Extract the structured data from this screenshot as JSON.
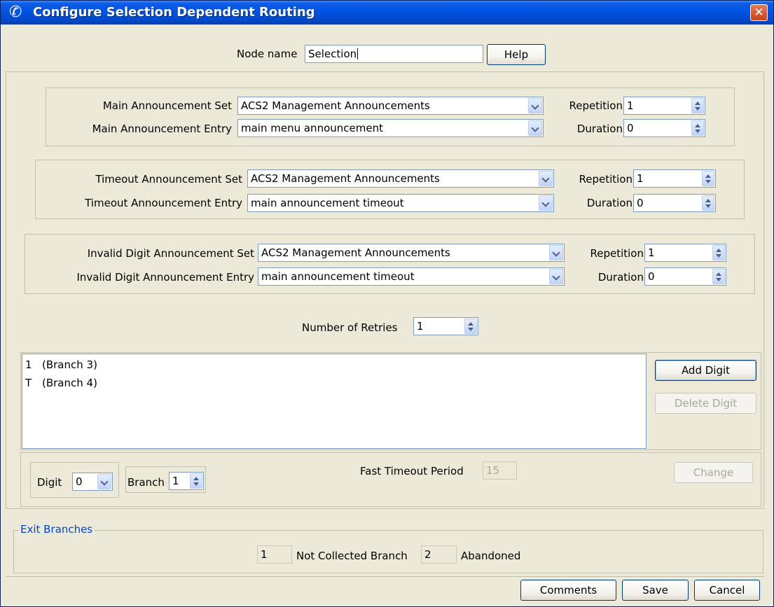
{
  "window": {
    "title": "Configure Selection Dependent Routing",
    "close_glyph": "✕",
    "icon": "phone-icon"
  },
  "node": {
    "label": "Node name",
    "value": "Selection",
    "help_label": "Help"
  },
  "main": {
    "set_label": "Main Announcement Set",
    "set_value": "ACS2 Management Announcements",
    "entry_label": "Main Announcement Entry",
    "entry_value": "main menu announcement",
    "repetition_label": "Repetition",
    "repetition_value": "1",
    "duration_label": "Duration",
    "duration_value": "0"
  },
  "timeout": {
    "set_label": "Timeout Announcement Set",
    "set_value": "ACS2 Management Announcements",
    "entry_label": "Timeout Announcement Entry",
    "entry_value": "main announcement timeout",
    "repetition_label": "Repetition",
    "repetition_value": "1",
    "duration_label": "Duration",
    "duration_value": "0"
  },
  "invalid": {
    "set_label": "Invalid Digit Announcement Set",
    "set_value": "ACS2 Management Announcements",
    "entry_label": "Invalid Digit Announcement Entry",
    "entry_value": "main announcement timeout",
    "repetition_label": "Repetition",
    "repetition_value": "1",
    "duration_label": "Duration",
    "duration_value": "0"
  },
  "retries": {
    "label": "Number of Retries",
    "value": "1"
  },
  "digit_list": [
    {
      "digit": "1",
      "branch": "(Branch 3)"
    },
    {
      "digit": "T",
      "branch": "(Branch 4)"
    }
  ],
  "digit_buttons": {
    "add": "Add Digit",
    "delete": "Delete Digit"
  },
  "editor": {
    "digit_label": "Digit",
    "digit_value": "0",
    "branch_label": "Branch",
    "branch_value": "1",
    "fast_timeout_label": "Fast Timeout Period",
    "fast_timeout_value": "15",
    "change_label": "Change"
  },
  "exit_branches": {
    "legend": "Exit Branches",
    "not_collected_value": "1",
    "not_collected_label": "Not Collected Branch",
    "abandoned_value": "2",
    "abandoned_label": "Abandoned"
  },
  "footer": {
    "comments": "Comments",
    "save": "Save",
    "cancel": "Cancel"
  }
}
